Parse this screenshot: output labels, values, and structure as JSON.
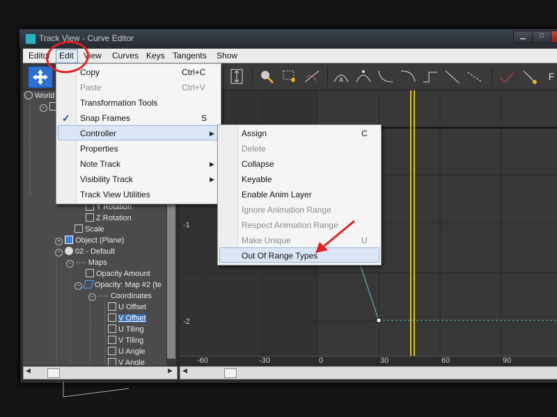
{
  "window": {
    "title": "Track View - Curve Editor"
  },
  "menubar": {
    "items": [
      "Editor",
      "Edit",
      "View",
      "Curves",
      "Keys",
      "Tangents",
      "Show"
    ]
  },
  "edit_menu": {
    "items": [
      {
        "label": "Copy",
        "shortcut": "Ctrl+C",
        "disabled": false
      },
      {
        "label": "Paste",
        "shortcut": "Ctrl+V",
        "disabled": true
      },
      {
        "label": "Transformation Tools",
        "submenu": true
      },
      {
        "label": "Snap Frames",
        "shortcut": "S",
        "checked": true
      },
      {
        "label": "Controller",
        "submenu": true,
        "highlighted": true
      },
      {
        "label": "Properties"
      },
      {
        "label": "Note Track",
        "submenu": true
      },
      {
        "label": "Visibility Track",
        "submenu": true
      },
      {
        "label": "Track View Utilities"
      }
    ],
    "submenu_arrow": "▶",
    "check_mark": "✓"
  },
  "controller_menu": {
    "items": [
      {
        "label": "Assign",
        "shortcut": "C",
        "disabled": false
      },
      {
        "label": "Delete",
        "disabled": true
      },
      {
        "label": "Collapse",
        "disabled": false
      },
      {
        "label": "Keyable",
        "disabled": false
      },
      {
        "label": "Enable Anim Layer",
        "disabled": false
      },
      {
        "label": "Ignore Animation Range",
        "disabled": true
      },
      {
        "label": "Respect Animation Range",
        "disabled": true
      },
      {
        "label": "Make Unique",
        "shortcut": "U",
        "disabled": true
      },
      {
        "label": "Out Of Range Types",
        "highlighted": true
      }
    ]
  },
  "tree": {
    "items": [
      {
        "label": "World",
        "icon": "world-icon"
      },
      {
        "label": "Y Rotation",
        "icon": "track-icon"
      },
      {
        "label": "Z Rotation",
        "icon": "track-icon"
      },
      {
        "label": "Scale",
        "icon": "scale-icon"
      },
      {
        "label": "Object (Plane)",
        "icon": "object-icon"
      },
      {
        "label": "02 - Default",
        "icon": "material-icon"
      },
      {
        "label": "Maps"
      },
      {
        "label": "Opacity Amount",
        "icon": "track-icon"
      },
      {
        "label": "Opacity: Map #2 (te",
        "icon": "map-icon"
      },
      {
        "label": "Coordinates"
      },
      {
        "label": "U Offset",
        "icon": "track-icon"
      },
      {
        "label": "V Offset",
        "icon": "track-icon",
        "selected": true
      },
      {
        "label": "U Tiling",
        "icon": "track-icon"
      },
      {
        "label": "V Tiling",
        "icon": "track-icon"
      },
      {
        "label": "U Angle",
        "icon": "track-icon"
      },
      {
        "label": "V Angle",
        "icon": "track-icon"
      }
    ]
  },
  "graph": {
    "y_labels": [
      "-1",
      "-2"
    ],
    "x_labels": [
      "-60",
      "-30",
      "0",
      "30",
      "60",
      "90"
    ],
    "curve_color": "#5cc8d6",
    "time_slider_color": "#d8c020"
  },
  "annotation_colors": {
    "circle": "#e02222",
    "arrow": "#e02222"
  }
}
